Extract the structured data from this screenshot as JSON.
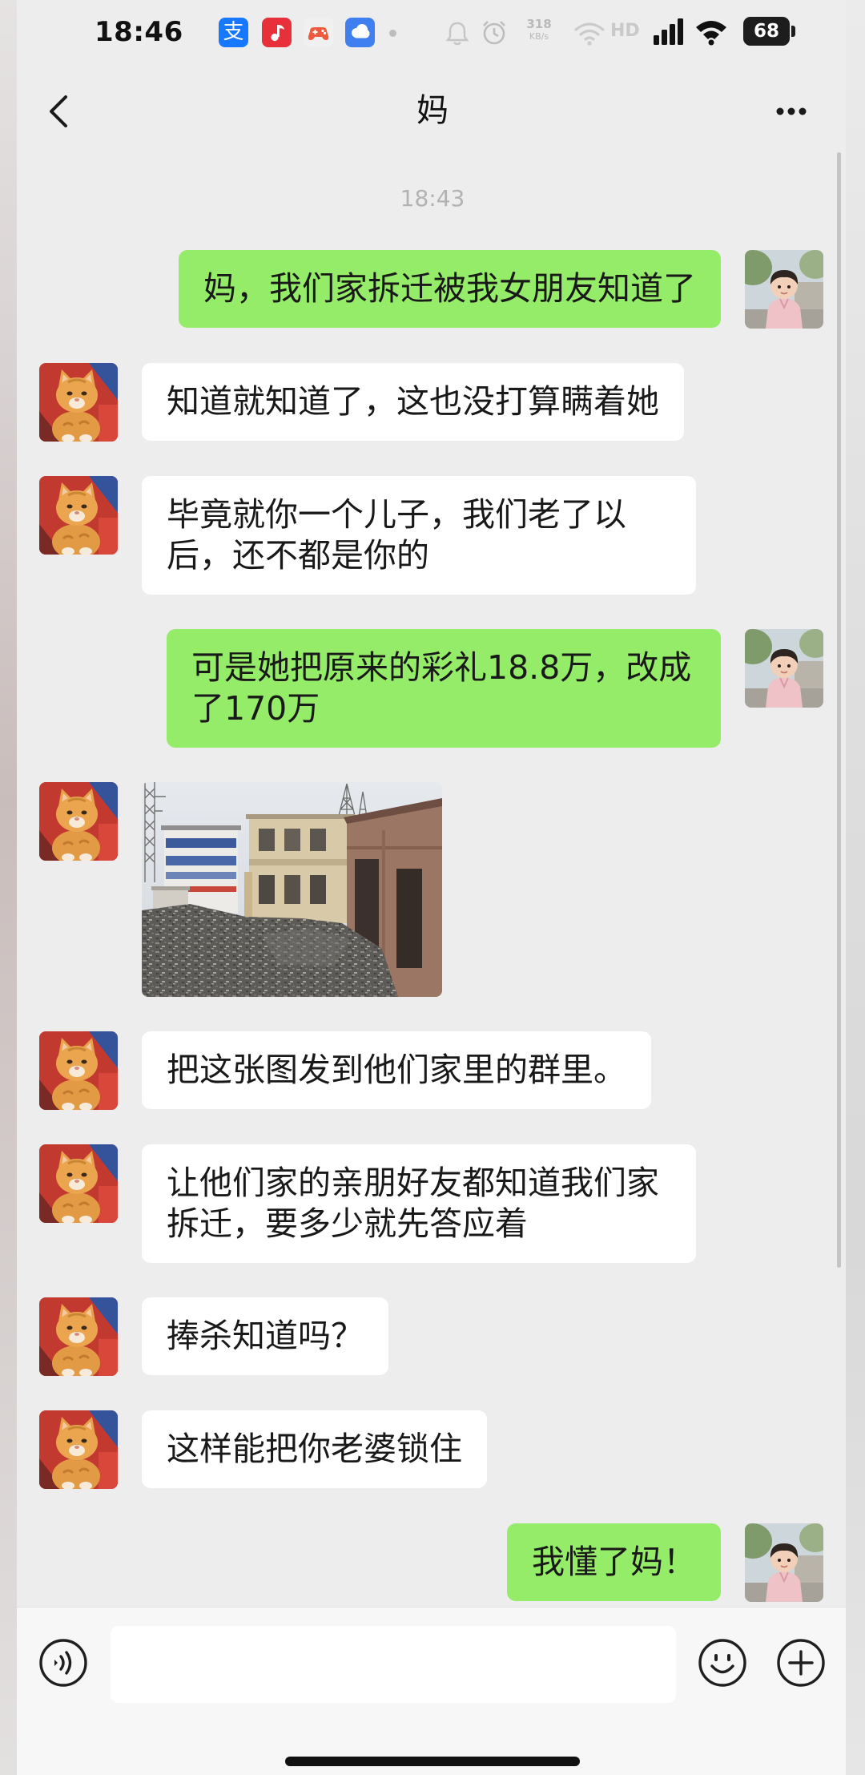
{
  "status_bar": {
    "time": "18:46",
    "alipay_glyph": "支",
    "net_speed": "318",
    "net_speed_unit": "KB/s",
    "signal_label": "HD",
    "battery_level": "68",
    "app_icons": [
      "alipay-icon",
      "music-app-icon",
      "game-app-icon",
      "chat-app-icon"
    ],
    "system_icons": [
      "bell-icon",
      "alarm-icon",
      "wifi-icon",
      "signal-icon",
      "battery-icon"
    ]
  },
  "header": {
    "title": "妈",
    "back_icon": "chevron-left-icon",
    "more_icon": "more-dots-icon"
  },
  "timestamp": "18:43",
  "avatars": {
    "contact": "orange-cat-avatar",
    "me": "toddler-avatar"
  },
  "messages": [
    {
      "outgoing": true,
      "text": "妈，我们家拆迁被我女朋友知道了"
    },
    {
      "outgoing": false,
      "text": "知道就知道了，这也没打算瞒着她"
    },
    {
      "outgoing": false,
      "text": "毕竟就你一个儿子，我们老了以后，还不都是你的"
    },
    {
      "outgoing": true,
      "text": "可是她把原来的彩礼18.8万，改成了170万"
    },
    {
      "outgoing": false,
      "image": "demolition-site-photo"
    },
    {
      "outgoing": false,
      "text": "把这张图发到他们家里的群里。"
    },
    {
      "outgoing": false,
      "text": "让他们家的亲朋好友都知道我们家拆迁，要多少就先答应着"
    },
    {
      "outgoing": false,
      "text": "捧杀知道吗？"
    },
    {
      "outgoing": false,
      "text": "这样能把你老婆锁住"
    },
    {
      "outgoing": true,
      "text": "我懂了妈！"
    }
  ],
  "input_bar": {
    "input_value": "",
    "voice_icon": "voice-input-icon",
    "emoji_icon": "emoji-icon",
    "plus_icon": "plus-icon"
  },
  "colors": {
    "background": "#ededed",
    "sent_bubble": "#95ec69",
    "received_bubble": "#ffffff",
    "input_bar": "#f7f7f7"
  }
}
